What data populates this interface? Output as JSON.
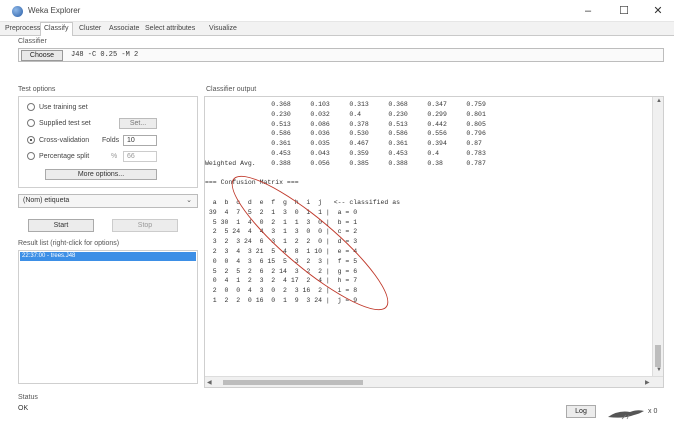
{
  "window": {
    "title": "Weka Explorer",
    "min_symbol": "–",
    "max_symbol": "☐",
    "close_symbol": "✕"
  },
  "tabs": [
    "Preprocess",
    "Classify",
    "Cluster",
    "Associate",
    "Select attributes",
    "Visualize"
  ],
  "active_tab": "Classify",
  "classifier": {
    "section_label": "Classifier",
    "choose_label": "Choose",
    "name": "J48 -C 0.25 -M 2"
  },
  "test_options": {
    "section_label": "Test options",
    "use_training": "Use training set",
    "supplied": "Supplied test set",
    "set_button": "Set...",
    "cross_validation": "Cross-validation",
    "folds_label": "Folds",
    "folds_value": "10",
    "percentage": "Percentage split",
    "percent_sign": "%",
    "percent_value": "66",
    "more_options": "More options..."
  },
  "class_attribute": "(Nom) etiqueta",
  "start_label": "Start",
  "stop_label": "Stop",
  "result_list": {
    "label": "Result list (right-click for options)",
    "items": [
      "22:37:00 - trees.J48"
    ]
  },
  "output": {
    "label": "Classifier output",
    "lines": [
      "                 0.368     0.103     0.313     0.368     0.347     0.759",
      "                 0.230     0.032     0.4       0.230     0.299     0.801",
      "                 0.513     0.086     0.378     0.513     0.442     0.805",
      "                 0.586     0.036     0.530     0.586     0.556     0.796",
      "                 0.361     0.035     0.467     0.361     0.394     0.87",
      "                 0.453     0.043     0.359     0.453     0.4       0.783",
      "Weighted Avg.    0.388     0.056     0.385     0.388     0.38      0.787",
      "",
      "=== Confusion Matrix ===",
      "",
      "  a  b  c  d  e  f  g  h  i  j   <-- classified as",
      " 39  4  7  5  2  1  3  0  1  1 |  a = 0",
      "  5 30  1  4  0  2  1  1  3  0 |  b = 1",
      "  2  5 24  4  4  3  1  3  0  0 |  c = 2",
      "  3  2  3 24  6  3  1  2  2  0 |  d = 3",
      "  2  3  4  3 21  5  4  8  1 10 |  e = 4",
      "  0  0  4  3  6 15  5  3  2  3 |  f = 5",
      "  5  2  5  2  6  2 14  3  2  2 |  g = 6",
      "  0  4  1  2  3  2  4 17  2  4 |  h = 7",
      "  2  0  0  4  3  0  2  3 16  2 |  i = 8",
      "  1  2  2  0 16  0  1  9  3 24 |  j = 9"
    ]
  },
  "status": {
    "label": "Status",
    "text": "OK"
  },
  "log_label": "Log",
  "x_count": "x 0",
  "colors": {
    "selection": "#3d8fe6",
    "annotation": "#c0392b"
  }
}
